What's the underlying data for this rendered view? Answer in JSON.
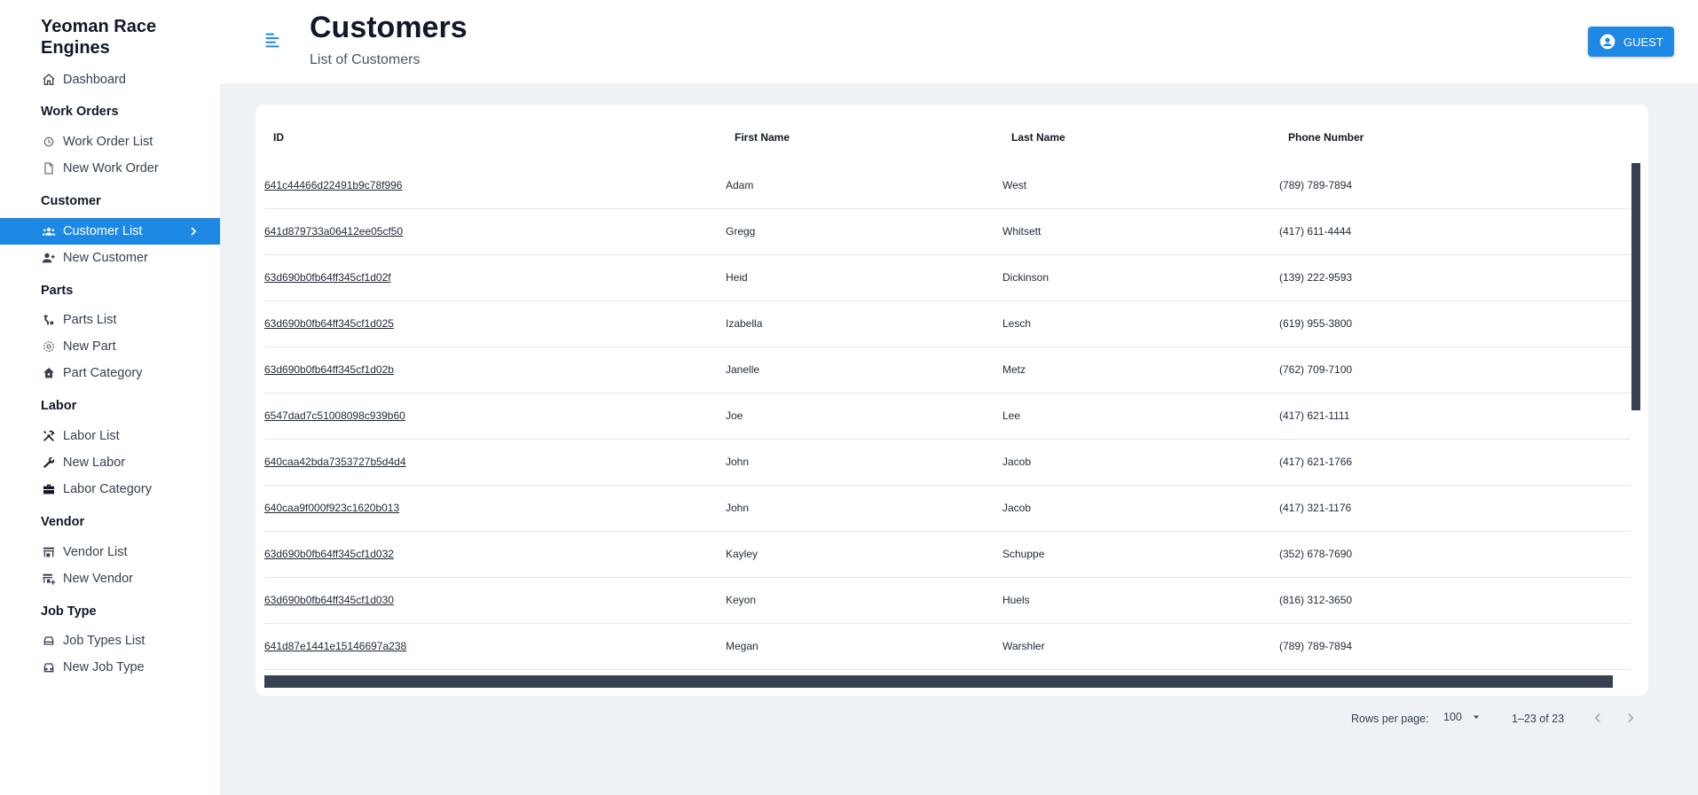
{
  "brand": "Yeoman Race Engines",
  "sidebar": {
    "dashboard": "Dashboard",
    "sections": [
      {
        "title": "Work Orders",
        "items": [
          "Work Order List",
          "New Work Order"
        ]
      },
      {
        "title": "Customer",
        "items": [
          "Customer List",
          "New Customer"
        ]
      },
      {
        "title": "Parts",
        "items": [
          "Parts List",
          "New Part",
          "Part Category"
        ]
      },
      {
        "title": "Labor",
        "items": [
          "Labor List",
          "New Labor",
          "Labor Category"
        ]
      },
      {
        "title": "Vendor",
        "items": [
          "Vendor List",
          "New Vendor"
        ]
      },
      {
        "title": "Job Type",
        "items": [
          "Job Types List",
          "New Job Type"
        ]
      }
    ],
    "active_item": "Customer List"
  },
  "header": {
    "title": "Customers",
    "subtitle": "List of Customers",
    "user_button": "GUEST"
  },
  "table": {
    "columns": [
      "ID",
      "First Name",
      "Last Name",
      "Phone Number"
    ],
    "rows": [
      [
        "641c44466d22491b9c78f996",
        "Adam",
        "West",
        "(789) 789-7894"
      ],
      [
        "641d879733a06412ee05cf50",
        "Gregg",
        "Whitsett",
        "(417) 611-4444"
      ],
      [
        "63d690b0fb64ff345cf1d02f",
        "Heid",
        "Dickinson",
        "(139) 222-9593"
      ],
      [
        "63d690b0fb64ff345cf1d025",
        "Izabella",
        "Lesch",
        "(619) 955-3800"
      ],
      [
        "63d690b0fb64ff345cf1d02b",
        "Janelle",
        "Metz",
        "(762) 709-7100"
      ],
      [
        "6547dad7c51008098c939b60",
        "Joe",
        "Lee",
        "(417) 621-1111"
      ],
      [
        "640caa42bda7353727b5d4d4",
        "John",
        "Jacob",
        "(417) 621-1766"
      ],
      [
        "640caa9f000f923c1620b013",
        "John",
        "Jacob",
        "(417) 321-1176"
      ],
      [
        "63d690b0fb64ff345cf1d032",
        "Kayley",
        "Schuppe",
        "(352) 678-7690"
      ],
      [
        "63d690b0fb64ff345cf1d030",
        "Keyon",
        "Huels",
        "(816) 312-3650"
      ],
      [
        "641d87e1441e15146697a238",
        "Megan",
        "Warshler",
        "(789) 789-7894"
      ]
    ]
  },
  "pagination": {
    "rows_per_page_label": "Rows per page:",
    "rows_per_page_value": "100",
    "range": "1–23 of 23"
  },
  "colors": {
    "accent": "#1e88e5",
    "background": "#eef1f6",
    "scrollbar": "#374151"
  },
  "icons": {
    "dashboard": "home-icon",
    "work-order-list": "clipboard-icon",
    "new-work-order": "file-icon",
    "customer-list": "groups-icon",
    "new-customer": "person-add-icon",
    "parts-list": "engine-icon",
    "new-part": "settings-icon",
    "part-category": "home-variant-icon",
    "labor-list": "tools-icon",
    "new-labor": "wrench-icon",
    "labor-category": "toolbox-icon",
    "vendor-list": "store-icon",
    "new-vendor": "store-add-icon",
    "job-types-list": "car-icon",
    "new-job-type": "car-outline-icon"
  }
}
